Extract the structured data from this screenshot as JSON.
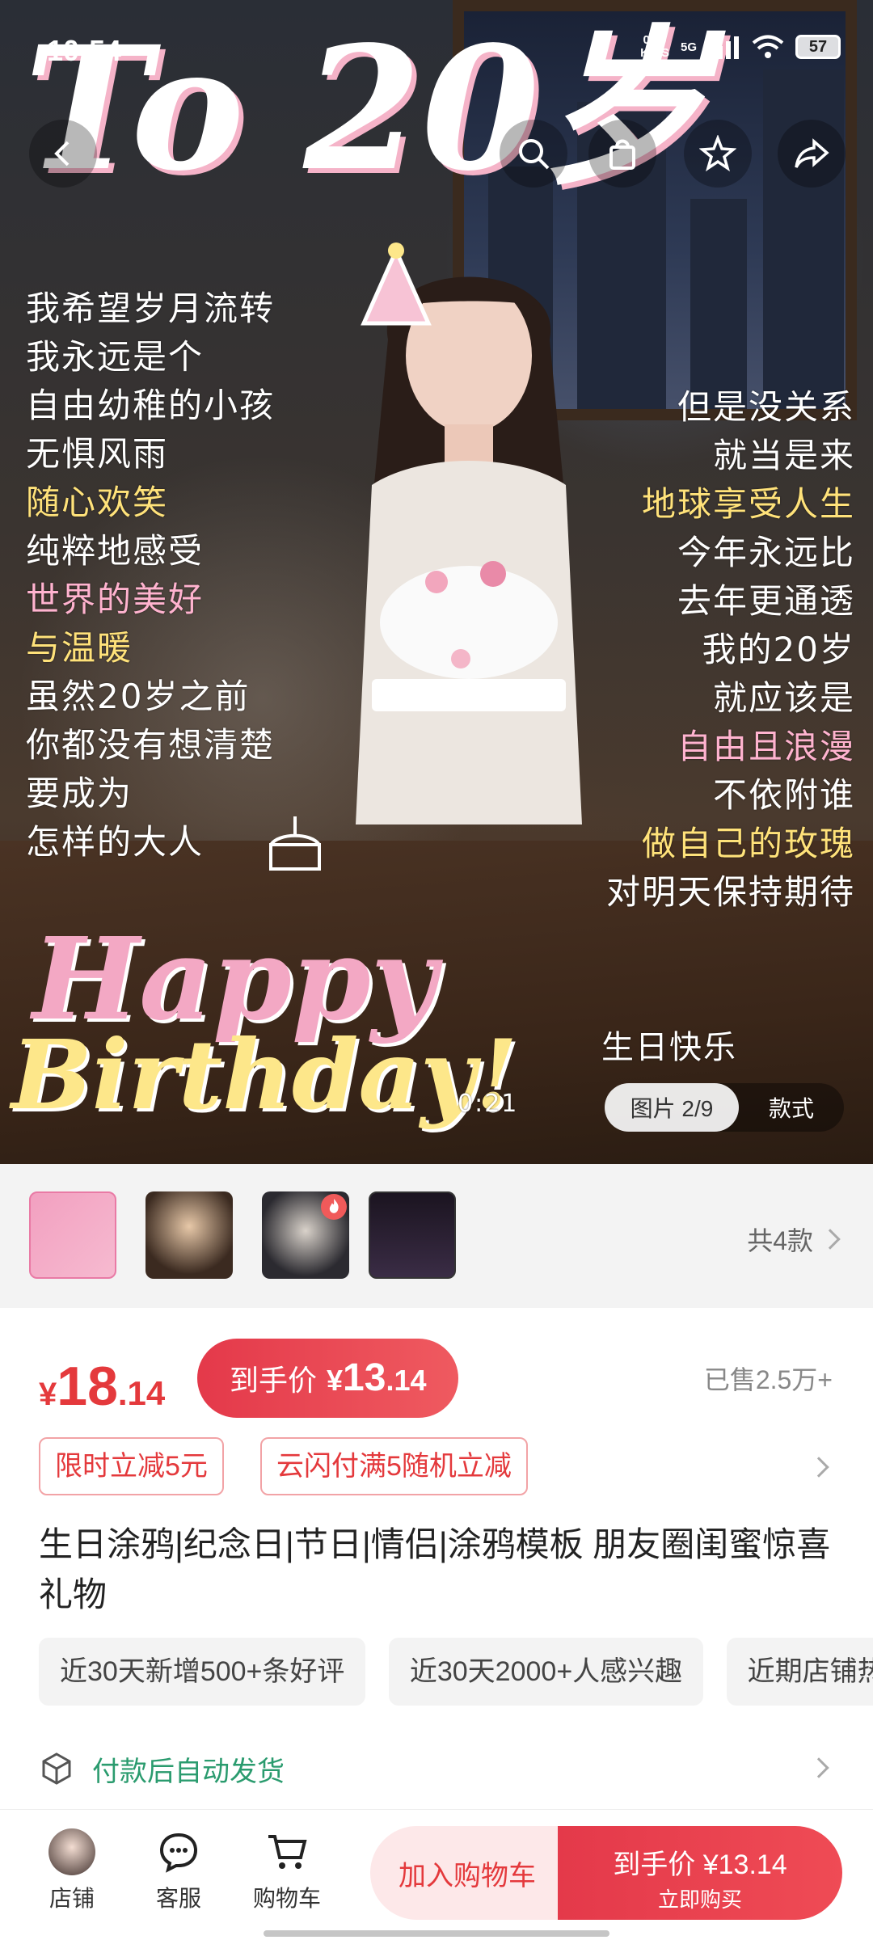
{
  "status_bar": {
    "time": "10:54",
    "net_speed_value": "0.00",
    "net_speed_unit": "KB/S",
    "network": "5G",
    "battery": "57"
  },
  "hero": {
    "doodle_title": "To 20岁",
    "poem_left": [
      "我希望岁月流转",
      "我永远是个",
      "自由幼稚的小孩",
      "无惧风雨",
      "随心欢笑",
      "纯粹地感受",
      "世界的美好",
      "与温暖",
      "虽然20岁之前",
      "你都没有想清楚",
      "要成为",
      "怎样的大人"
    ],
    "poem_right": [
      "但是没关系",
      "就当是来",
      "地球享受人生",
      "今年永远比",
      "去年更通透",
      "我的20岁",
      "就应该是",
      "自由且浪漫",
      "不依附谁",
      "做自己的玫瑰",
      "对明天保持期待"
    ],
    "happy_text": "Happy",
    "birthday_text": "Birthday!",
    "sticker_text": "生日快乐",
    "time_mark": "0:21",
    "image_counter": "图片 2/9",
    "style_label": "款式"
  },
  "variants": {
    "more_label": "共4款"
  },
  "price": {
    "currency": "¥",
    "integer": "18",
    "decimal": ".14",
    "final_label": "到手价",
    "final_currency": "¥",
    "final_integer": "13",
    "final_decimal": ".14",
    "sold": "已售2.5万+"
  },
  "promotions": [
    "限时立减5元",
    "云闪付满5随机立减"
  ],
  "product": {
    "title": "生日涂鸦|纪念日|节日|情侣|涂鸦模板  朋友圈闺蜜惊喜礼物"
  },
  "tags": [
    "近30天新增500+条好评",
    "近30天2000+人感兴趣",
    "近期店铺热卖"
  ],
  "shipping": "付款后自动发货",
  "bottom_bar": {
    "store_label": "店铺",
    "service_label": "客服",
    "cart_label": "购物车",
    "add_cart": "加入购物车",
    "buy_price": "到手价 ¥13.14",
    "buy_now": "立即购买"
  },
  "colors": {
    "accent": "#e4393c",
    "ship_green": "#2a9b6e"
  }
}
